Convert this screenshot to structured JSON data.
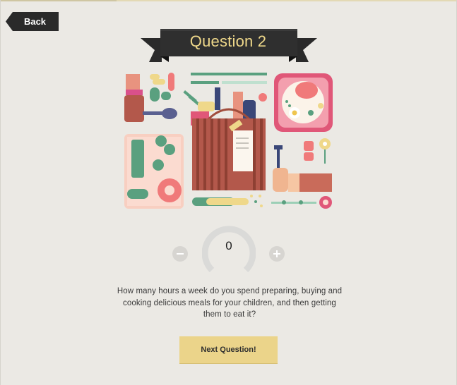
{
  "nav": {
    "back_label": "Back"
  },
  "header": {
    "question_title": "Question 2"
  },
  "counter": {
    "value": "0"
  },
  "question": {
    "text": "How many hours a week do you spend preparing, buying and cooking delicious meals for your children, and then getting them to eat it?"
  },
  "actions": {
    "next_label": "Next Question!"
  },
  "colors": {
    "background": "#ebe9e4",
    "banner": "#2a2a2a",
    "banner_text": "#efd88a",
    "next_button": "#ebd48a",
    "ring": "#dadad8"
  },
  "icons": [
    "minus-icon",
    "plus-icon",
    "food-illustration"
  ]
}
